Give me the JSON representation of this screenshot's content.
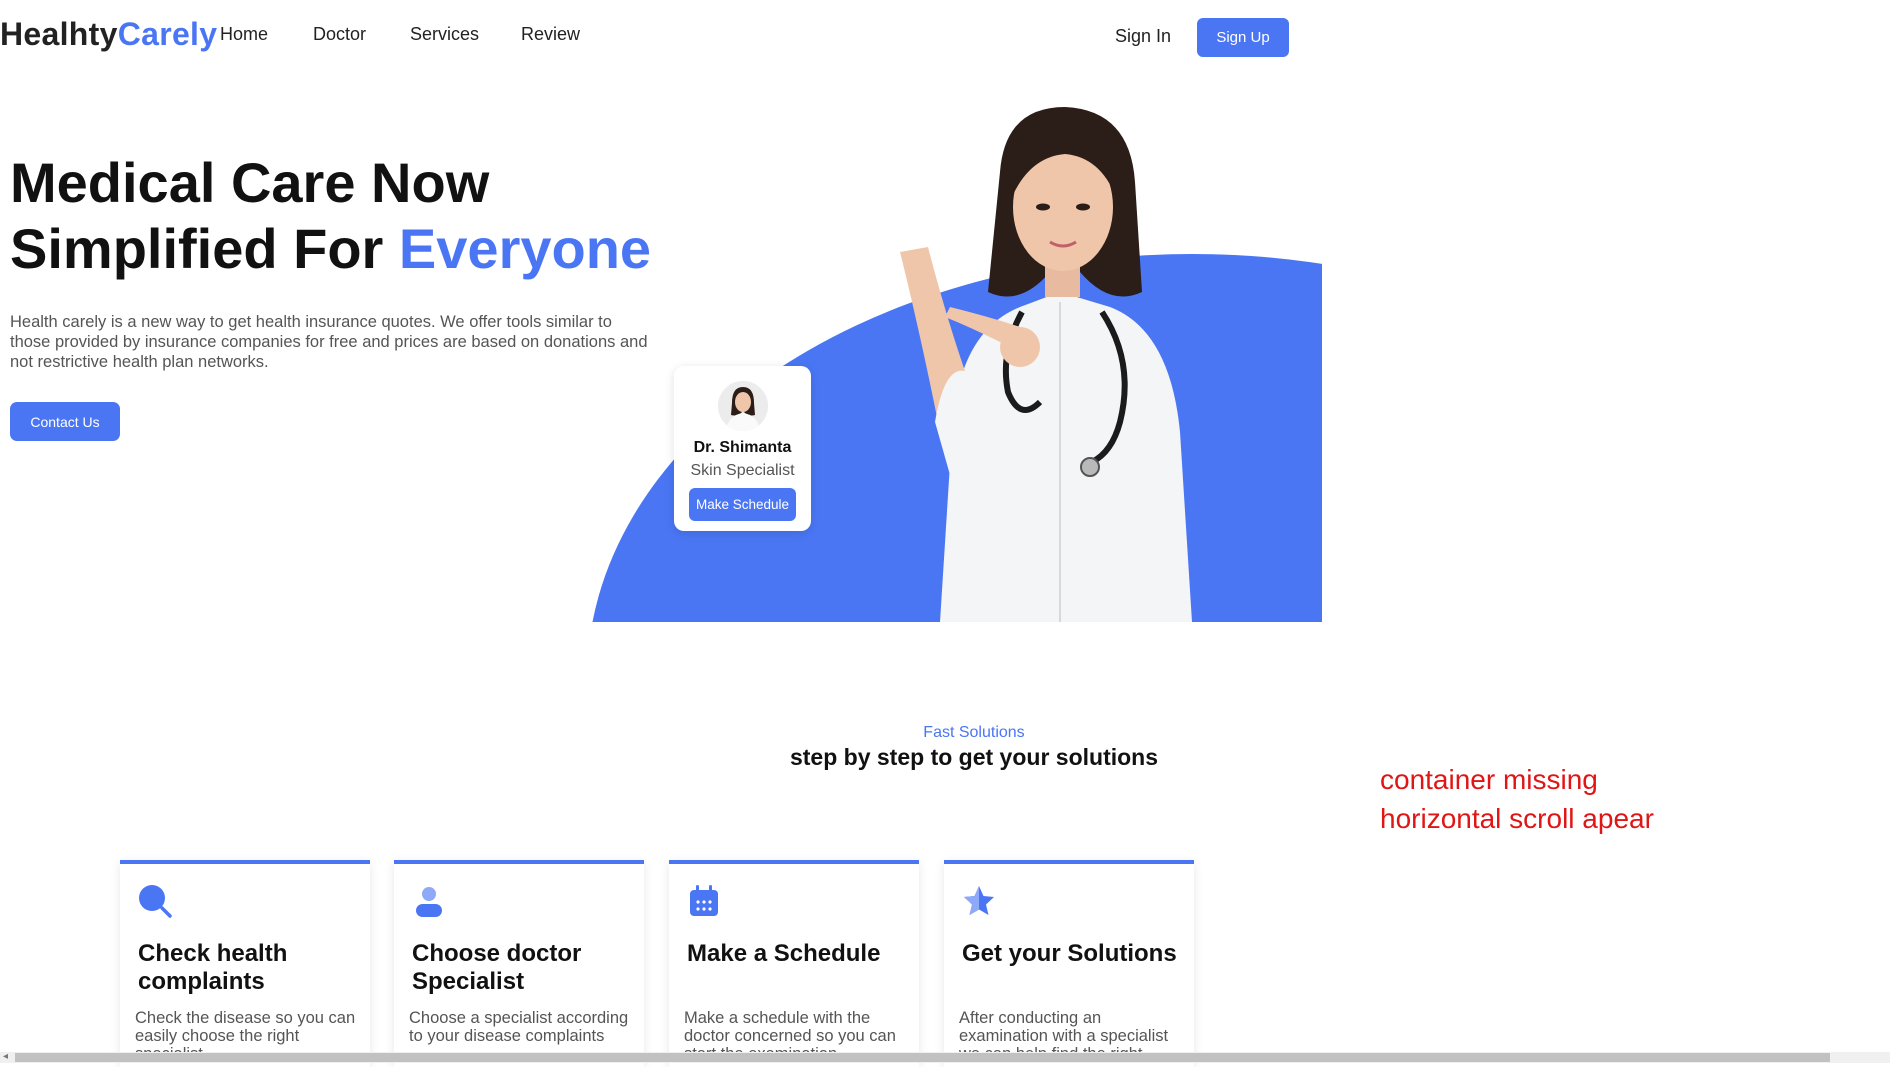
{
  "nav": {
    "brand_part1": "Healhty",
    "brand_part2": "Carely",
    "links": [
      "Home",
      "Doctor",
      "Services",
      "Review"
    ],
    "sign_in": "Sign In",
    "sign_up": "Sign Up"
  },
  "hero": {
    "title_line1": "Medical Care Now",
    "title_line2_prefix": "Simplified For ",
    "title_line2_accent": "Everyone",
    "description": "Health carely is a new way to get health insurance quotes. We offer tools similar to those provided by insurance companies for free and prices are based on donations and not restrictive health plan networks.",
    "contact_button": "Contact Us"
  },
  "doctor_card": {
    "name": "Dr. Shimanta",
    "specialty": "Skin Specialist",
    "button": "Make Schedule"
  },
  "section": {
    "subtitle": "Fast Solutions",
    "title": "step by step to get your solutions"
  },
  "steps": [
    {
      "icon": "search-icon",
      "title": "Check health complaints",
      "desc": "Check the disease so you can easily choose the right specialist"
    },
    {
      "icon": "user-icon",
      "title": "Choose doctor Specialist",
      "desc": "Choose a specialist according to your disease complaints"
    },
    {
      "icon": "calendar-icon",
      "title": "Make a Schedule",
      "desc": "Make a schedule with the doctor concerned so you can start the examination"
    },
    {
      "icon": "star-icon",
      "title": "Get your Solutions",
      "desc": "After conducting an examination with a specialist we can help find the right"
    }
  ],
  "annotation": {
    "line1": "container missing",
    "line2": "horizontal scroll apear"
  },
  "colors": {
    "accent": "#4a76f4",
    "annotation": "#e01515"
  }
}
